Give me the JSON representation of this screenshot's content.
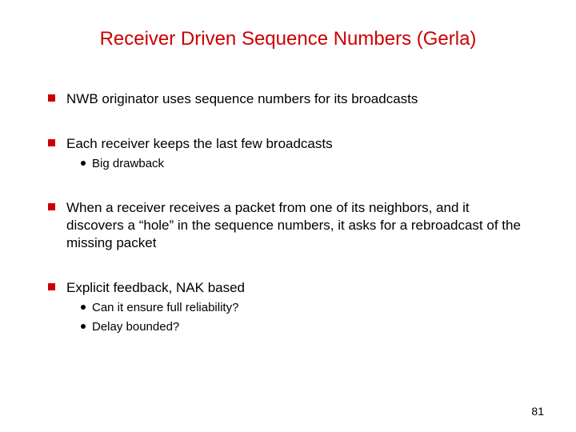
{
  "title": "Receiver Driven Sequence Numbers (Gerla)",
  "bullets": {
    "b1": {
      "text": "NWB originator uses sequence numbers for its broadcasts"
    },
    "b2": {
      "text": "Each receiver keeps the last few broadcasts",
      "sub1": "Big drawback"
    },
    "b3": {
      "text": "When a receiver receives a packet from one of its neighbors, and it discovers a “hole” in the sequence numbers, it asks for a rebroadcast of the missing packet"
    },
    "b4": {
      "text": "Explicit feedback, NAK based",
      "sub1": "Can it ensure full reliability?",
      "sub2": "Delay bounded?"
    }
  },
  "page_number": "81"
}
